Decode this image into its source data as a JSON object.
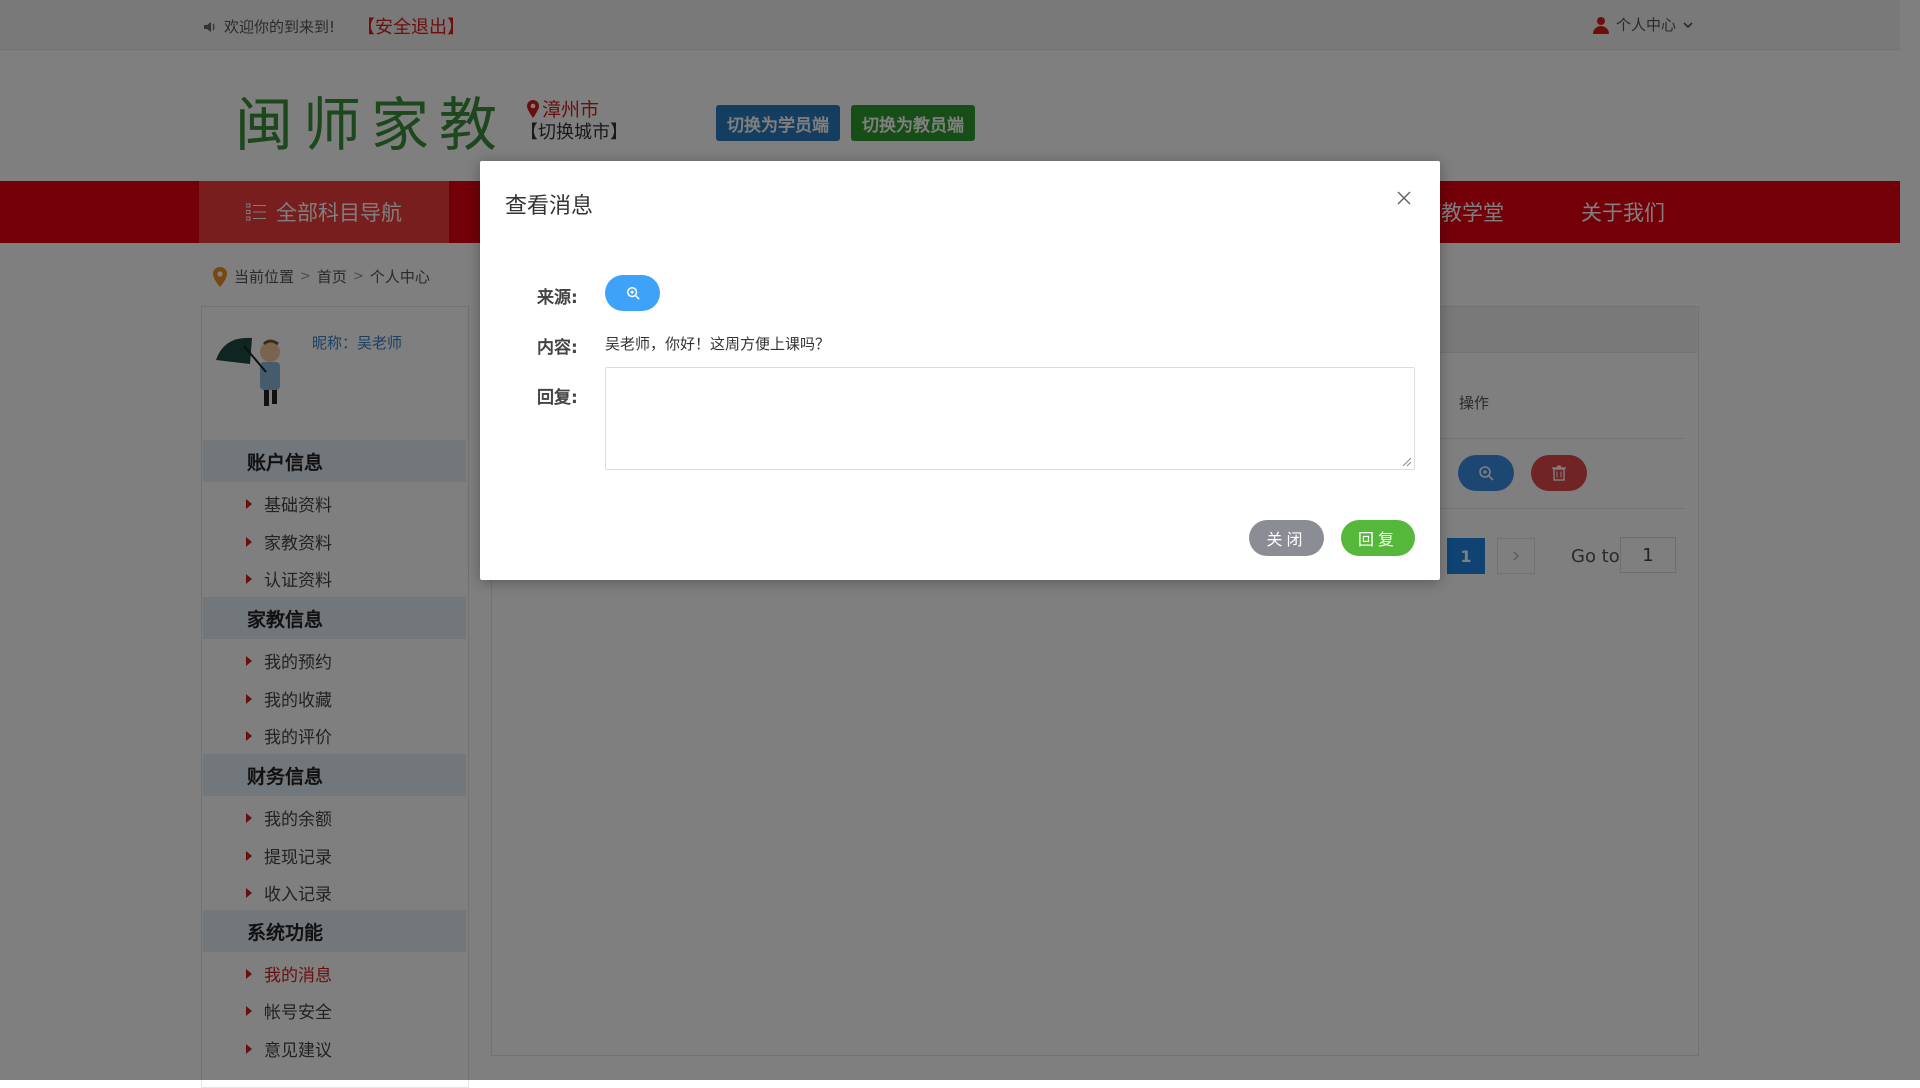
{
  "topbar": {
    "welcome": "欢迎你的到来到!",
    "logout": "【安全退出】",
    "user_center": "个人中心"
  },
  "header": {
    "logo": "闽师家教",
    "city": "漳州市",
    "switch_city": "【切换城市】",
    "switch_student": "切换为学员端",
    "switch_teacher": "切换为教员端"
  },
  "nav": {
    "all_subjects": "全部科目导航",
    "items": [
      "家教学堂",
      "关于我们"
    ]
  },
  "breadcrumb": [
    "当前位置",
    "首页",
    "个人中心"
  ],
  "sidebar": {
    "nickname": "昵称：吴老师",
    "sections": [
      {
        "title": "账户信息",
        "items": [
          "基础资料",
          "家教资料",
          "认证资料"
        ]
      },
      {
        "title": "家教信息",
        "items": [
          "我的预约",
          "我的收藏",
          "我的评价"
        ]
      },
      {
        "title": "财务信息",
        "items": [
          "我的余额",
          "提现记录",
          "收入记录"
        ]
      },
      {
        "title": "系统功能",
        "items": [
          "我的消息",
          "帐号安全",
          "意见建议"
        ]
      }
    ],
    "active_item": "我的消息"
  },
  "table": {
    "op_header": "操作",
    "page": "1",
    "goto_label": "Go to",
    "goto_value": "1"
  },
  "modal": {
    "title": "查看消息",
    "source_label": "来源:",
    "content_label": "内容:",
    "content": "吴老师，你好！这周方便上课吗？",
    "reply_label": "回复:",
    "reply_value": "",
    "close_btn": "关闭",
    "reply_btn": "回复"
  },
  "colors": {
    "nav_red": "#e60012",
    "primary_blue": "#3ea2f8",
    "success_green": "#55b83b",
    "danger_red": "#e04848"
  }
}
